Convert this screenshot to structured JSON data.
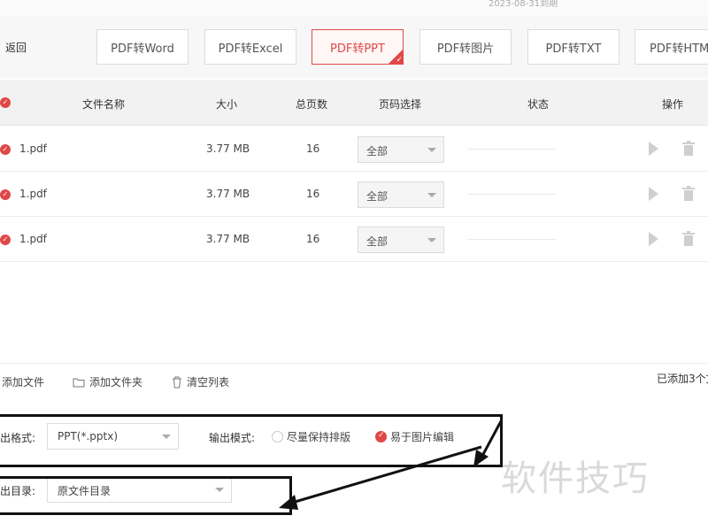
{
  "header": {
    "date_text": "2023-08-31到期"
  },
  "toolbar": {
    "back_label": "返回",
    "tabs": [
      {
        "label": "PDF转Word"
      },
      {
        "label": "PDF转Excel"
      },
      {
        "label": "PDF转PPT",
        "active": true
      },
      {
        "label": "PDF转图片"
      },
      {
        "label": "PDF转TXT"
      },
      {
        "label": "PDF转HTML"
      }
    ]
  },
  "table": {
    "headers": {
      "name": "文件名称",
      "size": "大小",
      "pages": "总页数",
      "page_select": "页码选择",
      "status": "状态",
      "ops": "操作"
    },
    "rows": [
      {
        "name": "1.pdf",
        "size": "3.77 MB",
        "pages": "16",
        "page_select": "全部"
      },
      {
        "name": "1.pdf",
        "size": "3.77 MB",
        "pages": "16",
        "page_select": "全部"
      },
      {
        "name": "1.pdf",
        "size": "3.77 MB",
        "pages": "16",
        "page_select": "全部"
      }
    ]
  },
  "actions": {
    "add_file": "添加文件",
    "add_folder": "添加文件夹",
    "clear_list": "清空列表",
    "added_count": "已添加3个文"
  },
  "settings": {
    "format_label": "出格式:",
    "format_value": "PPT(*.pptx)",
    "mode_label": "输出模式:",
    "mode_options": [
      {
        "label": "尽量保持排版",
        "selected": false
      },
      {
        "label": "易于图片编辑",
        "selected": true
      }
    ],
    "dir_label": "出目录:",
    "dir_value": "原文件目录"
  },
  "watermark": "软件技巧",
  "colors": {
    "accent": "#e04848",
    "annotation": "#111111"
  }
}
